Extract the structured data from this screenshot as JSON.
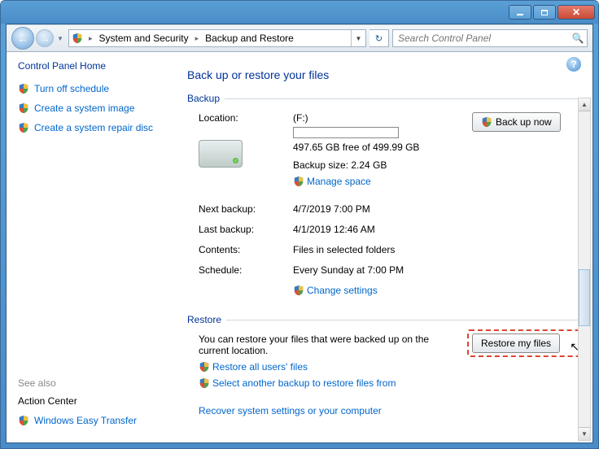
{
  "titlebar": {
    "min": "-",
    "max": "□",
    "close": "✕"
  },
  "nav": {
    "back": "←",
    "fwd": "→",
    "segments": [
      "System and Security",
      "Backup and Restore"
    ],
    "refresh": "↻"
  },
  "search": {
    "placeholder": "Search Control Panel"
  },
  "sidebar": {
    "home": "Control Panel Home",
    "links": [
      "Turn off schedule",
      "Create a system image",
      "Create a system repair disc"
    ],
    "see_also_label": "See also",
    "see_also": [
      "Action Center",
      "Windows Easy Transfer"
    ]
  },
  "help": "?",
  "main": {
    "title": "Back up or restore your files",
    "backup_hdr": "Backup",
    "location_label": "Location:",
    "location_value": "(F:)",
    "free_text": "497.65 GB free of 499.99 GB",
    "backup_size_label": "Backup size: 2.24 GB",
    "manage_space": "Manage space",
    "backup_now": "Back up now",
    "rows": [
      {
        "label": "Next backup:",
        "value": "4/7/2019 7:00 PM"
      },
      {
        "label": "Last backup:",
        "value": "4/1/2019 12:46 AM"
      },
      {
        "label": "Contents:",
        "value": "Files in selected folders"
      },
      {
        "label": "Schedule:",
        "value": "Every Sunday at 7:00 PM"
      }
    ],
    "change_settings": "Change settings",
    "restore_hdr": "Restore",
    "restore_text": "You can restore your files that were backed up on the current location.",
    "restore_my_files": "Restore my files",
    "restore_all": "Restore all users' files",
    "select_another": "Select another backup to restore files from",
    "recover": "Recover system settings or your computer"
  }
}
